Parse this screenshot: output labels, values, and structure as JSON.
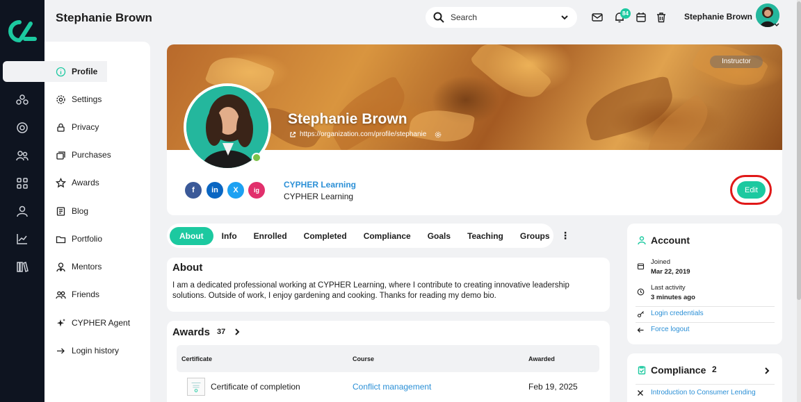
{
  "header": {
    "app_title": "Stephanie Brown",
    "search_placeholder": "Search",
    "notification_count": "84",
    "user_name": "Stephanie Brown"
  },
  "rail": {
    "icons": [
      "home-icon",
      "modules-icon",
      "target-icon",
      "groups-icon",
      "apps-icon",
      "user-icon",
      "analytics-icon",
      "library-icon"
    ]
  },
  "sidebar": {
    "items": [
      {
        "label": "Profile",
        "icon": "info-icon"
      },
      {
        "label": "Settings",
        "icon": "gear-icon"
      },
      {
        "label": "Privacy",
        "icon": "lock-icon"
      },
      {
        "label": "Purchases",
        "icon": "purchases-icon"
      },
      {
        "label": "Awards",
        "icon": "star-icon"
      },
      {
        "label": "Blog",
        "icon": "blog-icon"
      },
      {
        "label": "Portfolio",
        "icon": "folder-icon"
      },
      {
        "label": "Mentors",
        "icon": "mentor-icon"
      },
      {
        "label": "Friends",
        "icon": "friends-icon"
      },
      {
        "label": "CYPHER Agent",
        "icon": "sparkle-icon"
      },
      {
        "label": "Login history",
        "icon": "login-icon"
      }
    ]
  },
  "profile": {
    "role_tag": "Instructor",
    "name": "Stephanie Brown",
    "url": "https://organization.com/profile/stephanie",
    "social": [
      "f",
      "in",
      "X",
      "ig"
    ],
    "org_link": "CYPHER Learning",
    "org_text": "CYPHER Learning",
    "edit_label": "Edit"
  },
  "tabs": [
    "About",
    "Info",
    "Enrolled",
    "Completed",
    "Compliance",
    "Goals",
    "Teaching",
    "Groups"
  ],
  "about": {
    "title": "About",
    "body": "I am a dedicated professional working at CYPHER Learning, where I contribute to creating innovative leadership solutions. Outside of work, I enjoy gardening and cooking. Thanks for reading my demo bio."
  },
  "awards": {
    "title": "Awards",
    "count": "37",
    "columns": [
      "Certificate",
      "Course",
      "Awarded"
    ],
    "rows": [
      {
        "certificate": "Certificate of completion",
        "course": "Conflict management",
        "awarded": "Feb 19, 2025"
      }
    ]
  },
  "account": {
    "title": "Account",
    "joined_label": "Joined",
    "joined_value": "Mar 22, 2019",
    "activity_label": "Last activity",
    "activity_value": "3 minutes ago",
    "login_credentials": "Login credentials",
    "force_logout": "Force logout"
  },
  "compliance": {
    "title": "Compliance",
    "count": "2",
    "item": "Introduction to Consumer Lending"
  },
  "colors": {
    "accent": "#1cc9a0",
    "rail": "#0e1420",
    "link": "#2a8fd6",
    "highlight_ring": "#e01818"
  }
}
